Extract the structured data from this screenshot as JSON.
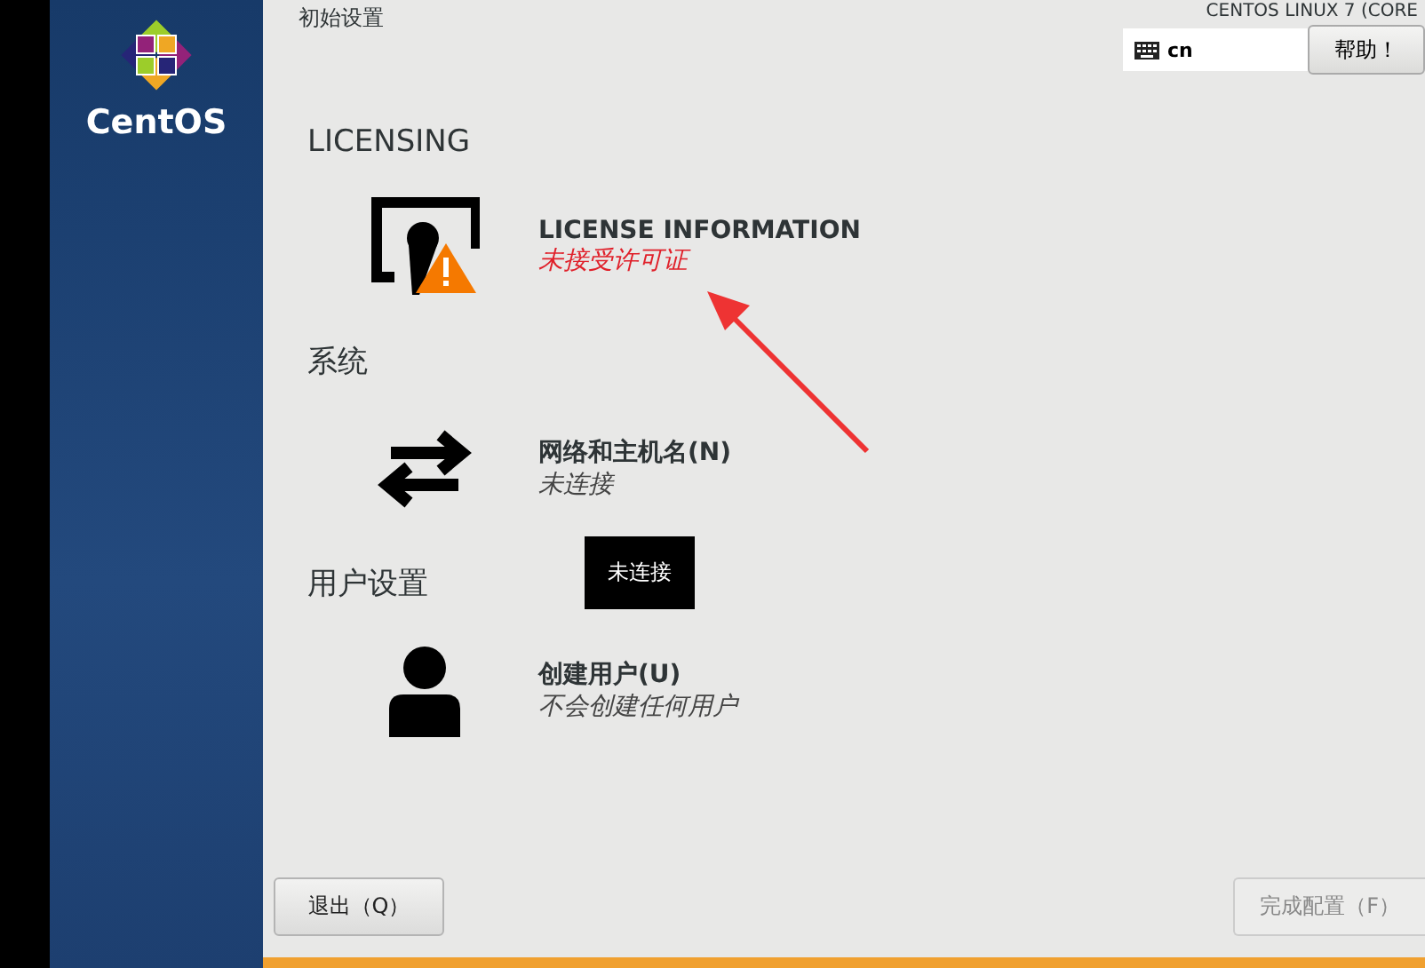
{
  "sidebar": {
    "logo_text": "CentOS"
  },
  "header": {
    "title": "初始设置",
    "product": "CENTOS LINUX 7 (CORE",
    "keyboard": "cn",
    "help_button": "帮助！"
  },
  "sections": [
    {
      "title": "LICENSING",
      "items": [
        {
          "kind": "license",
          "title": "LICENSE INFORMATION",
          "status": "未接受许可证",
          "warning": true
        }
      ]
    },
    {
      "title": "系统",
      "items": [
        {
          "kind": "network",
          "title": "网络和主机名(N)",
          "status": "未连接",
          "warning": false
        }
      ]
    },
    {
      "title": "用户设置",
      "items": [
        {
          "kind": "user",
          "title": "创建用户(U)",
          "status": "不会创建任何用户",
          "warning": false
        }
      ]
    }
  ],
  "tooltip": "未连接",
  "buttons": [
    {
      "label": "退出（Q）",
      "disabled": false
    },
    {
      "label": "完成配置（F）",
      "disabled": true
    }
  ]
}
